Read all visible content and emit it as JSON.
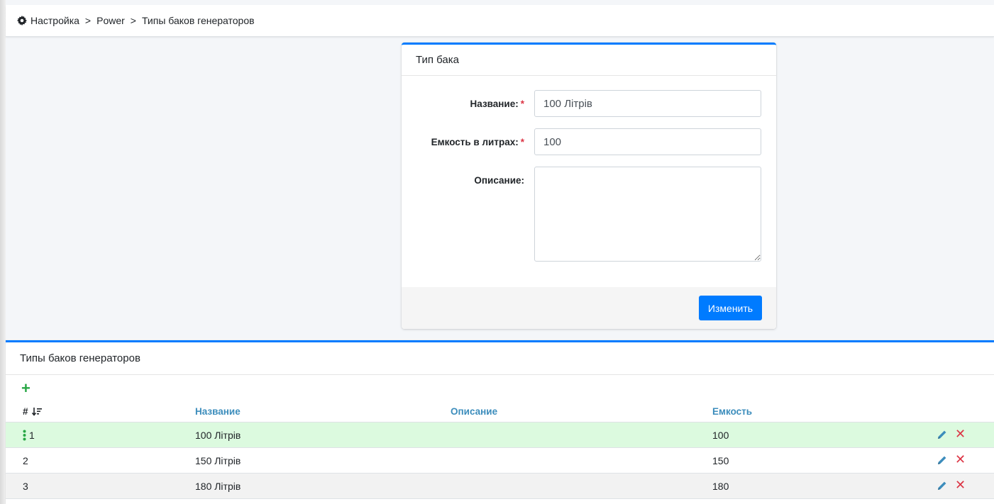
{
  "breadcrumb": {
    "items": [
      "Настройка",
      "Power",
      "Типы баков генераторов"
    ],
    "separator": ">"
  },
  "form": {
    "title": "Тип бака",
    "name_label": "Название:",
    "name_value": "100 Літрів",
    "capacity_label": "Емкость в литрах:",
    "capacity_value": "100",
    "description_label": "Описание:",
    "description_value": "",
    "required_mark": "*",
    "submit_label": "Изменить"
  },
  "table": {
    "title": "Типы баков генераторов",
    "add_icon": "+",
    "columns": {
      "num": "#",
      "name": "Название",
      "description": "Описание",
      "capacity": "Емкость"
    },
    "rows": [
      {
        "num": "1",
        "name": "100 Літрів",
        "description": "",
        "capacity": "100"
      },
      {
        "num": "2",
        "name": "150 Літрів",
        "description": "",
        "capacity": "150"
      },
      {
        "num": "3",
        "name": "180 Літрів",
        "description": "",
        "capacity": "180"
      }
    ],
    "delete_icon": "✕"
  },
  "colors": {
    "primary": "#007bff",
    "link_header": "#3c8dbc",
    "add_green": "#28a745",
    "delete_red": "#dc3545",
    "selected_row": "#dcfadf"
  }
}
